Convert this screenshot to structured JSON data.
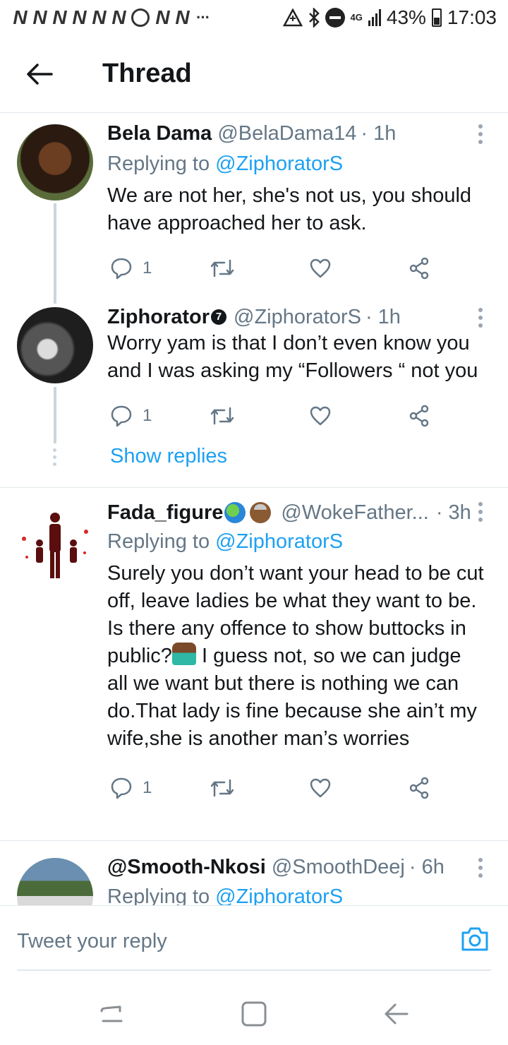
{
  "status_bar": {
    "time": "17:03",
    "battery": "43%",
    "network": "4G",
    "notification_icons": [
      "N",
      "N",
      "N",
      "N",
      "N",
      "N",
      "whatsapp",
      "N",
      "N"
    ],
    "overflow_dots": "···"
  },
  "header": {
    "title": "Thread",
    "back_icon": "arrow-left-icon"
  },
  "tweets": [
    {
      "name": "Bela Dama",
      "handle": "@BelaDama14",
      "time": "· 1h",
      "replying_prefix": "Replying to ",
      "replying_to": "@ZiphoratorS",
      "text": "We are not her, she's not us, you should have approached her to ask.",
      "reply_count": "1"
    },
    {
      "name": "Ziphorator",
      "badge": "7",
      "handle": "@ZiphoratorS",
      "time": "· 1h",
      "text": "Worry yam is that I don’t even know you and I was asking my “Followers “ not you",
      "reply_count": "1",
      "show_replies": "Show replies"
    },
    {
      "name": "Fada_figure",
      "handle": "@WokeFather...",
      "time": "· 3h",
      "replying_prefix": "Replying to ",
      "replying_to": "@ZiphoratorS",
      "text_part1": "Surely you don’t want your head to be cut off, leave ladies be what they want to be. Is there any offence to show buttocks in public?",
      "text_part2": " I guess not, so we can judge all we want but there is nothing we can do.That lady is fine because she ain’t my wife,she is another man’s worries",
      "reply_count": "1"
    },
    {
      "name": "@Smooth-Nkosi",
      "handle": "@SmoothDeej",
      "time": "· 6h",
      "replying_prefix": "Replying to ",
      "replying_to": "@ZiphoratorS"
    }
  ],
  "reply_bar": {
    "placeholder": "Tweet your reply"
  },
  "colors": {
    "link": "#1da1f2",
    "muted": "#657786",
    "text": "#14171a",
    "divider": "#e1e8ed"
  }
}
